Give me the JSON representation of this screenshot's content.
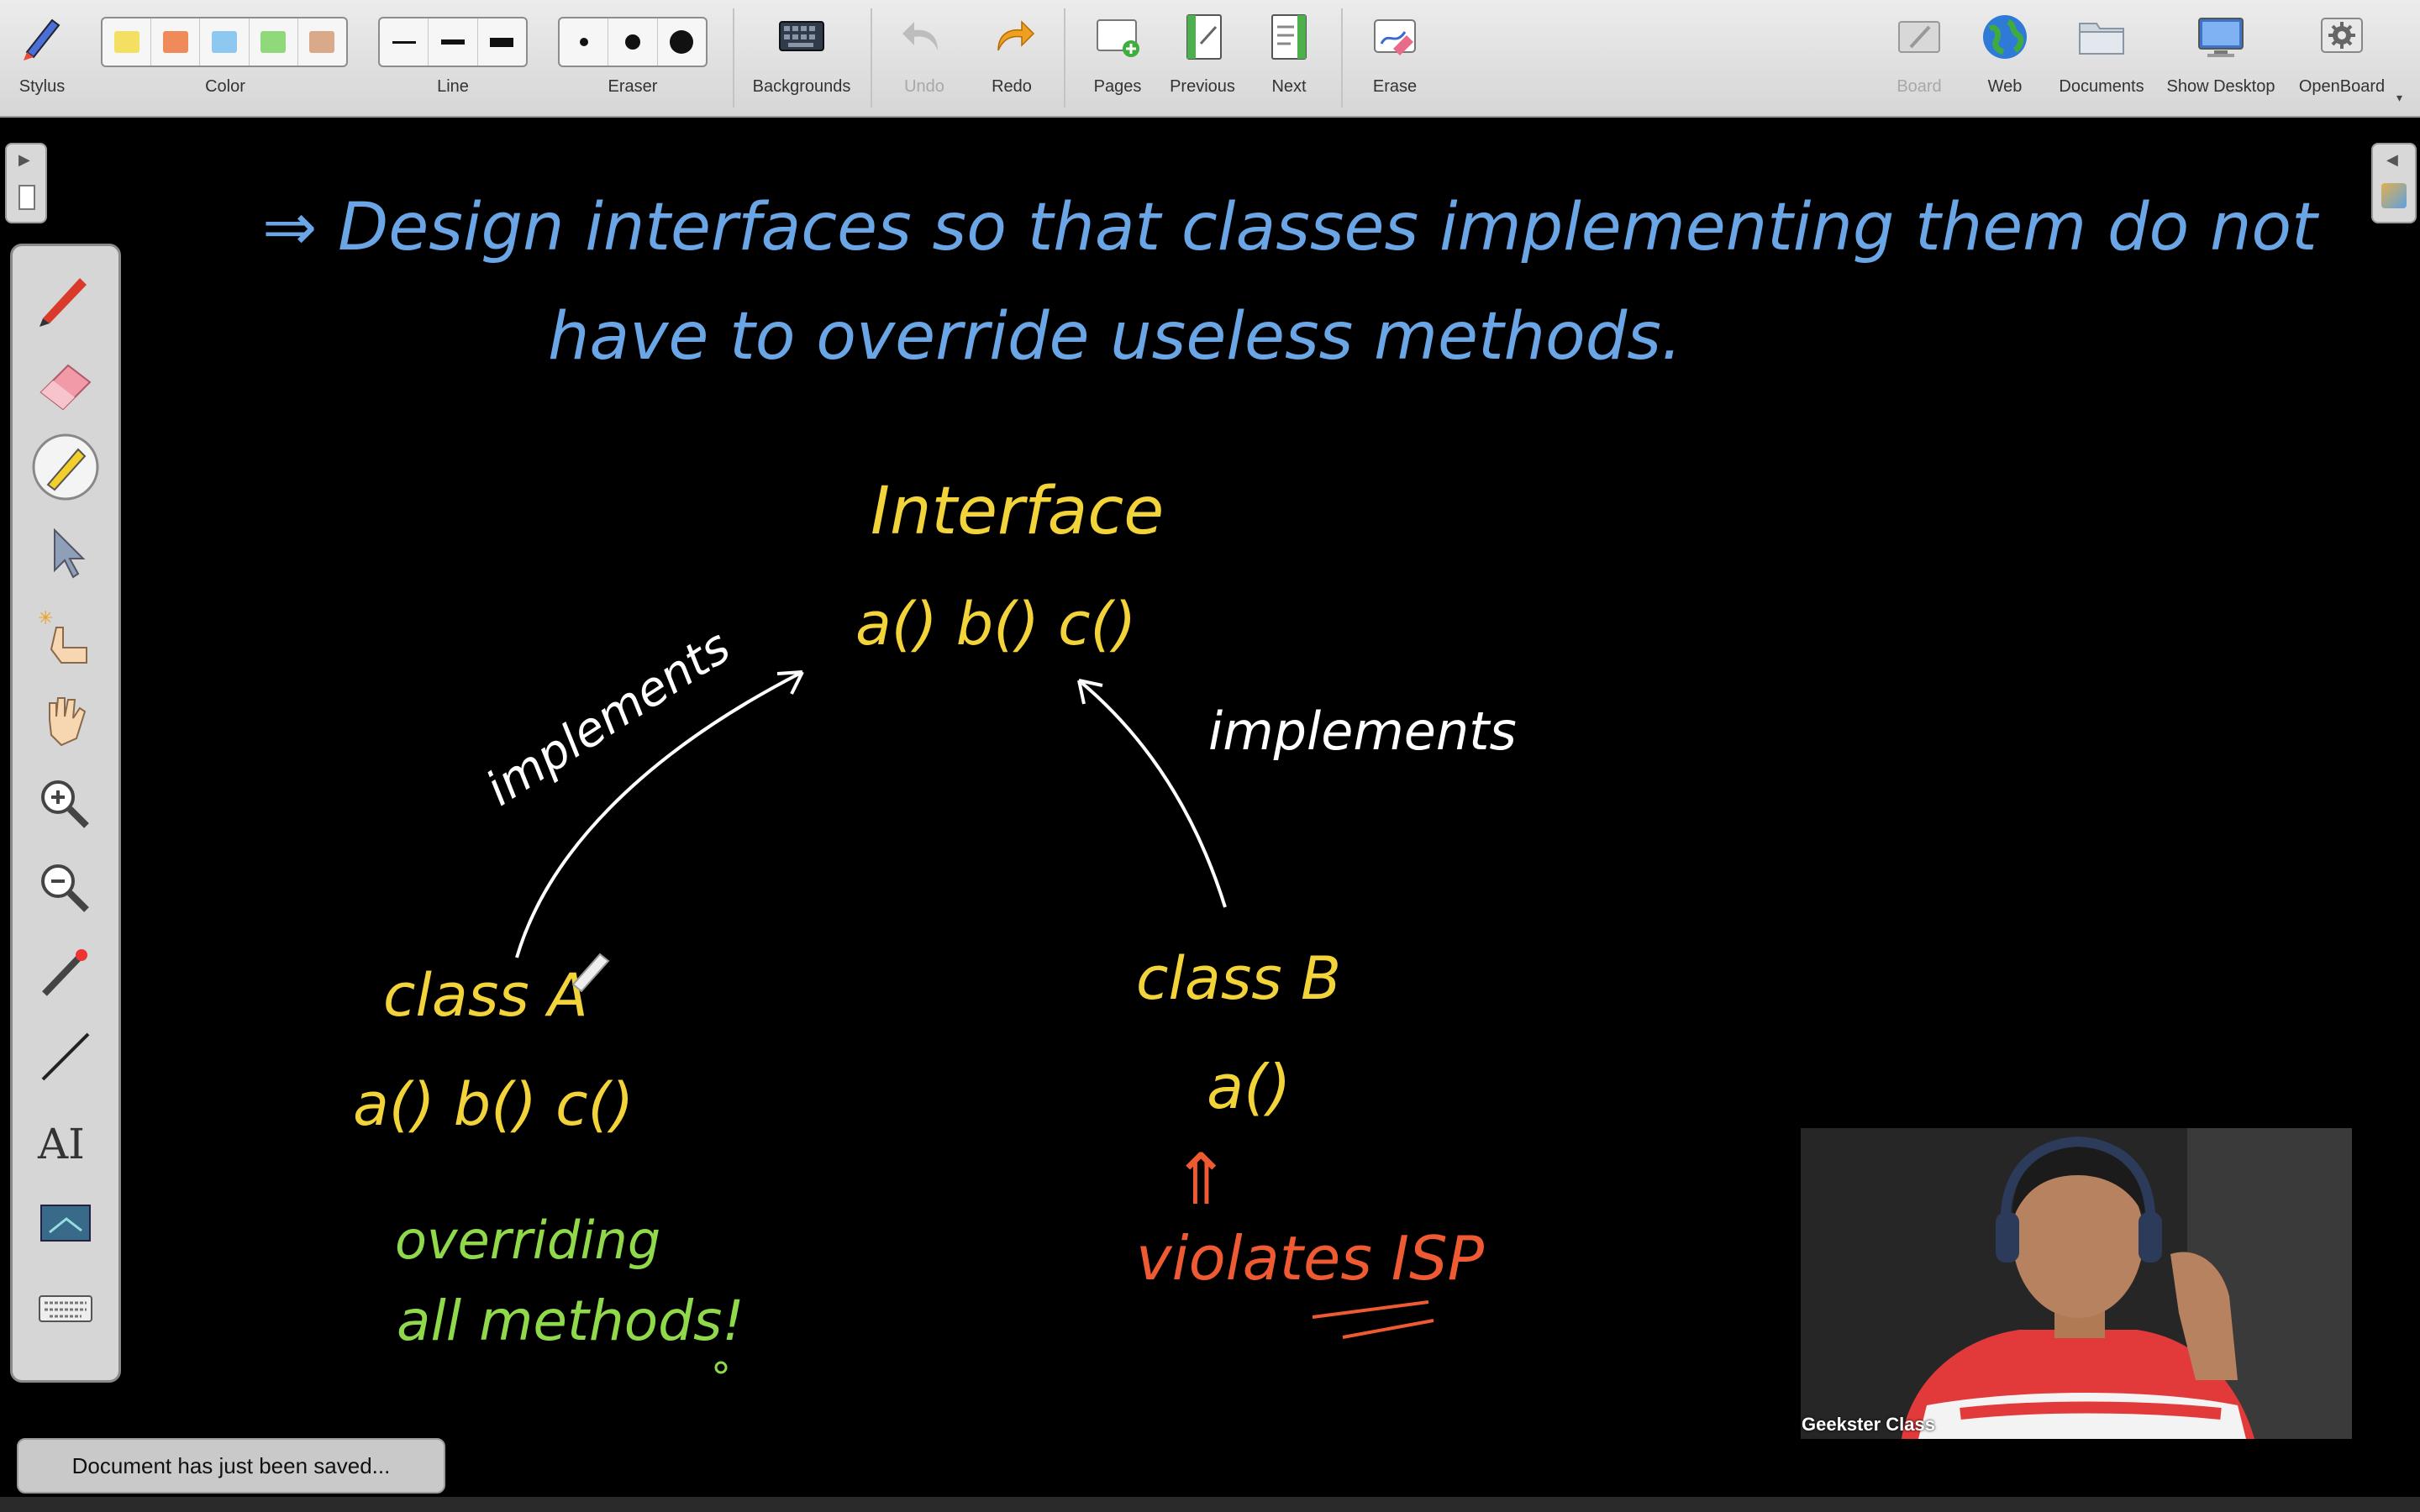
{
  "toolbar": {
    "stylus": "Stylus",
    "color": "Color",
    "line": "Line",
    "eraser": "Eraser",
    "backgrounds": "Backgrounds",
    "undo": "Undo",
    "redo": "Redo",
    "pages": "Pages",
    "previous": "Previous",
    "next": "Next",
    "erase": "Erase",
    "board": "Board",
    "web": "Web",
    "documents": "Documents",
    "show_desktop": "Show Desktop",
    "openboard": "OpenBoard",
    "color_swatches": [
      "#f3df62",
      "#ef8a5a",
      "#8ec7ef",
      "#8fd97a",
      "#d9a98a"
    ]
  },
  "board": {
    "heading_line1": "⇒ Design interfaces so that classes implementing them do not",
    "heading_line2": "have to override useless methods.",
    "interface_title": "Interface",
    "interface_methods": "a() b() c()",
    "implements_left": "implements",
    "implements_right": "implements",
    "class_a": "class A",
    "class_a_methods": "a() b() c()",
    "overriding_line1": "overriding",
    "overriding_line2": "all methods!",
    "class_b": "class B",
    "class_b_methods": "a()",
    "violation_arrow": "⇑",
    "violates": "violates ISP"
  },
  "webcam": {
    "label": "Geekster Class"
  },
  "toast": {
    "message": "Document has just been saved..."
  }
}
